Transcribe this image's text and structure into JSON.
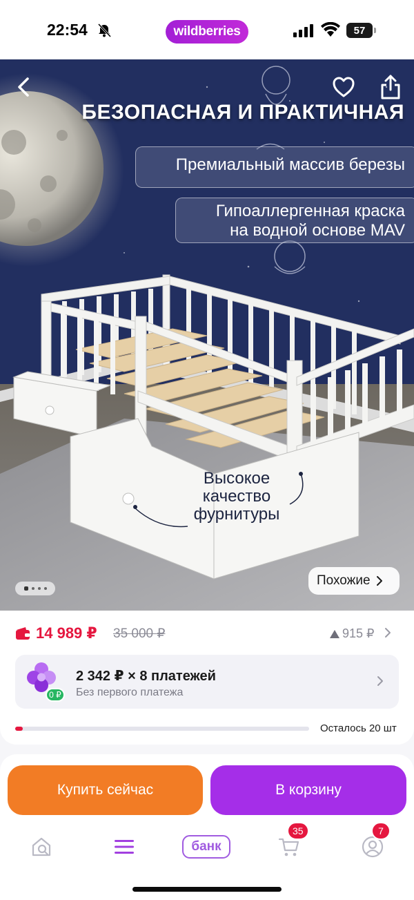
{
  "status_bar": {
    "time": "22:54",
    "app_pill": "wildberries",
    "battery": "57",
    "icons": [
      "bell-off-icon",
      "signal-icon",
      "wifi-icon",
      "battery-icon"
    ]
  },
  "hero": {
    "title": "БЕЗОПАСНАЯ И ПРАКТИЧНАЯ",
    "tag1": "Премиальный массив березы",
    "tag2_line1": "Гипоаллергенная краска",
    "tag2_line2": "на водной основе MAV",
    "fittings_line1": "Высокое",
    "fittings_line2": "качество",
    "fittings_line3": "фурнитуры",
    "similar_label": "Похожие",
    "pager": {
      "count": 4,
      "active": 0
    },
    "colors": {
      "wall": "#223262",
      "floor": "#7f7f86",
      "bed": "#f2f2f0",
      "slats": "#e6cfa6"
    }
  },
  "price": {
    "current": "14 989 ₽",
    "old": "35 000 ₽",
    "change": "915 ₽",
    "accent": "#e5173f"
  },
  "installment": {
    "title": "2 342 ₽ × 8 платежей",
    "subtitle": "Без первого платежа",
    "badge": "0 ₽"
  },
  "stock": {
    "label": "Осталось 20 шт",
    "fill_fraction": 0.025
  },
  "actions": {
    "buy_now": "Купить сейчас",
    "add_to_cart": "В корзину",
    "buy_color": "#f27c25",
    "cart_color": "#a52ee8"
  },
  "tabbar": {
    "bank_label": "банк",
    "cart_count": "35",
    "profile_count": "7",
    "icons": [
      "home-search-icon",
      "menu-icon",
      "bank-icon",
      "cart-icon",
      "profile-icon"
    ]
  }
}
